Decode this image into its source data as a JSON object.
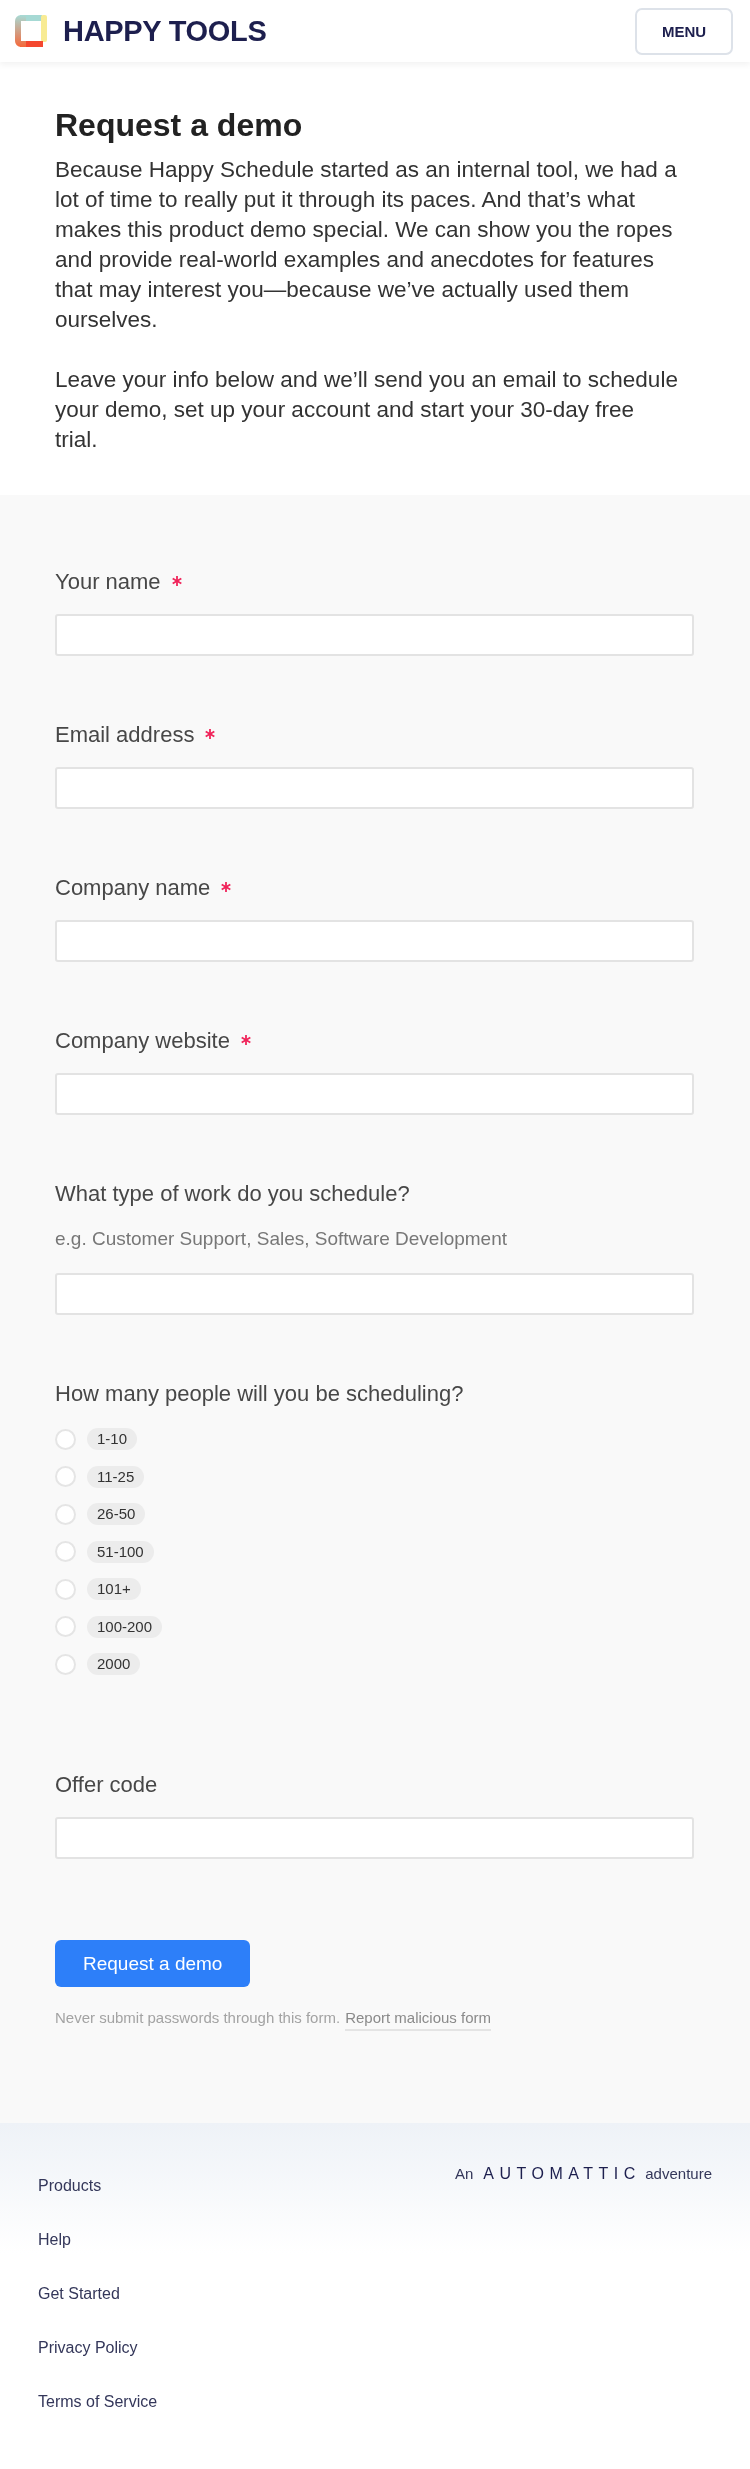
{
  "header": {
    "brand": "HAPPY TOOLS",
    "menu_button": "MENU"
  },
  "intro": {
    "title": "Request a demo",
    "paragraphs": [
      "Because Happy Schedule started as an internal tool, we had a lot of time to really put it through its paces. And that’s what makes this product demo special. We can show you the ropes and provide real-world examples and anecdotes for features that may interest you—because we’ve actually used them ourselves.",
      "Leave your info below and we’ll send you an email to schedule your demo, set up your account and start your 30-day free trial."
    ]
  },
  "form": {
    "fields": [
      {
        "kind": "text",
        "label": "Your name",
        "required": true
      },
      {
        "kind": "text",
        "label": "Email address",
        "required": true
      },
      {
        "kind": "text",
        "label": "Company name",
        "required": true
      },
      {
        "kind": "text",
        "label": "Company website",
        "required": true
      },
      {
        "kind": "text",
        "label": "What type of work do you schedule?",
        "required": false,
        "hint": "e.g. Customer Support, Sales, Software Development"
      },
      {
        "kind": "radio",
        "label": "How many people will you be scheduling?",
        "required": false,
        "options": [
          {
            "label": "1-10",
            "selected": false
          },
          {
            "label": "11-25",
            "selected": false
          },
          {
            "label": "26-50",
            "selected": false
          },
          {
            "label": "51-100",
            "selected": false
          },
          {
            "label": "101+",
            "selected": false
          },
          {
            "label": "100-200",
            "selected": false
          },
          {
            "label": "2000",
            "selected": false
          }
        ]
      },
      {
        "kind": "text",
        "label": "Offer code",
        "required": false
      }
    ],
    "submit_button": "Request a demo",
    "notice": "Never submit passwords through this form.",
    "report_link": "Report malicious form"
  },
  "footer": {
    "links": [
      "Products",
      "Help",
      "Get Started",
      "Privacy Policy",
      "Terms of Service"
    ],
    "credit": {
      "prefix": "An",
      "brand": "AUTOMATTIC",
      "suffix": "adventure"
    }
  }
}
